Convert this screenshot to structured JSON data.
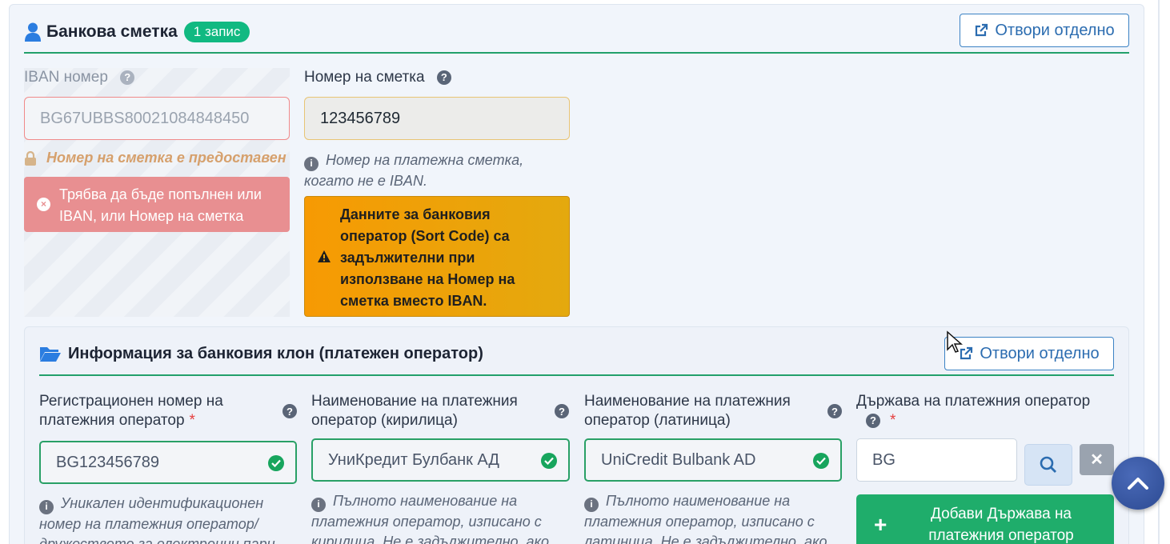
{
  "bank_account": {
    "title": "Банкова сметка",
    "badge": "1 запис",
    "open_separately": "Отвори отделно",
    "iban": {
      "label": "IBAN номер",
      "value": "BG67UBBS80021084848450",
      "lock_note": "Номер на сметка е предоставен",
      "error": "Трябва да бъде попълнен или IBAN, или Номер на сметка"
    },
    "account_number": {
      "label": "Номер на сметка",
      "value": "123456789",
      "hint": "Номер на платежна сметка, когато не е IBAN.",
      "warning": "Данните за банковия оператор (Sort Code) са задължителни при използване на Номер на сметка вместо IBAN."
    }
  },
  "branch": {
    "title": "Информация за банковия клон (платежен оператор)",
    "open_separately": "Отвори отделно",
    "reg_number": {
      "label": "Регистрационен номер на платежния оператор",
      "required": "*",
      "value": "BG123456789",
      "hint": "Уникален идентификационен номер на платежния оператор/ дружеството за електронни пари —"
    },
    "name_cyrillic": {
      "label": "Наименование на платежния оператор (кирилица)",
      "value": "УниКредит Булбанк АД",
      "hint": "Пълното наименование на платежния оператор, изписано с кирилица. Не е задължително, ако"
    },
    "name_latin": {
      "label": "Наименование на платежния оператор (латиница)",
      "value": "UniCredit Bulbank AD",
      "hint": "Пълното наименование на платежния оператор, изписано с латиница. Не е задължително, ако"
    },
    "country": {
      "label": "Държава на платежния оператор",
      "required": "*",
      "value": "BG",
      "add_button": "Добави Държава на платежния оператор"
    }
  },
  "icons": [
    "user-icon",
    "external-link-icon",
    "help-icon",
    "lock-icon",
    "error-icon",
    "info-icon",
    "warning-icon",
    "folder-open-icon",
    "check-icon",
    "search-icon",
    "close-icon",
    "plus-icon",
    "chevron-up-icon"
  ],
  "colors": {
    "accent_green": "#22a06b",
    "link_blue": "#2b6cb0",
    "error": "#e88f91",
    "warning": "#f79a03"
  }
}
